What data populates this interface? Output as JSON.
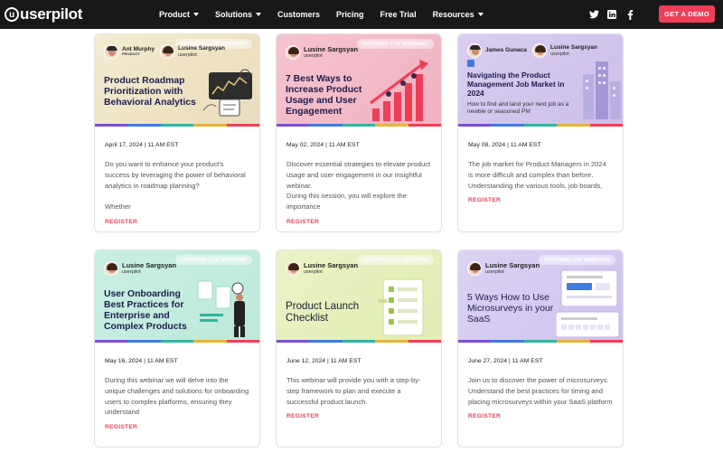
{
  "nav": {
    "logo": "userpilot",
    "logo_mark": "u",
    "items": [
      {
        "label": "Product",
        "dropdown": true
      },
      {
        "label": "Solutions",
        "dropdown": true
      },
      {
        "label": "Customers",
        "dropdown": false
      },
      {
        "label": "Pricing",
        "dropdown": false
      },
      {
        "label": "Free Trial",
        "dropdown": false
      },
      {
        "label": "Resources",
        "dropdown": true
      }
    ],
    "social": [
      "twitter-icon",
      "linkedin-icon",
      "facebook-icon"
    ],
    "cta": "GET A DEMO"
  },
  "colors": {
    "nav_bg": "#18181b",
    "accent": "#ef3e57",
    "title_navy": "#1d1d4f"
  },
  "cards": [
    {
      "badge": "UPCOMING LIVE WEBINARS",
      "hosts": [
        {
          "name": "Ant Murphy",
          "brand": "PRODUCT"
        },
        {
          "name": "Lusine Sargsyan",
          "brand": "userpilot"
        }
      ],
      "title": "Product Roadmap Prioritization with Behavioral Analytics",
      "date": "April 17, 2024 | 11 AM EST",
      "description": "Do you want to enhance your product's success by leveraging the power of behavioral analytics in roadmap planning?\n\nWhether",
      "register": "REGISTER"
    },
    {
      "badge": "UPCOMING LIVE WEBINARS",
      "hosts": [
        {
          "name": "Lusine Sargsyan",
          "brand": "userpilot"
        }
      ],
      "title": "7 Best Ways to Increase Product Usage and User Engagement",
      "date": "May 02, 2024 | 11 AM EST",
      "description": "Discover essential strategies to elevate product usage and user engagement in our insightful webinar.\nDuring this session, you will explore the importance",
      "register": "REGISTER"
    },
    {
      "badge": "",
      "hosts": [
        {
          "name": "James Gunaca",
          "brand": ""
        },
        {
          "name": "Lusine Sargsyan",
          "brand": "userpilot"
        }
      ],
      "title": "Navigating the Product Management Job Market in 2024",
      "subtitle": "How to find and land your next job as a newbie or seasoned PM",
      "date": "May 08, 2024 | 11 AM EST",
      "description": "The job market for Product Managers in 2024 is more difficult and complex than before. Understanding the various tools, job boards,",
      "register": "REGISTER"
    },
    {
      "badge": "UPCOMING LIVE WEBINARS",
      "hosts": [
        {
          "name": "Lusine Sargsyan",
          "brand": "userpilot"
        }
      ],
      "title": "User Onboarding Best Practices for Enterprise and Complex Products",
      "date": "May 16, 2024 | 11 AM EST",
      "description": "During this webinar we will delve into the unique challenges and solutions for onboarding users to complex platforms, ensuring they understand",
      "register": "REGISTER"
    },
    {
      "badge": "UPCOMING LIVE WEBINARS",
      "hosts": [
        {
          "name": "Lusine Sargsyan",
          "brand": "userpilot"
        }
      ],
      "title": "Product Launch Checklist",
      "date": "June 12, 2024 | 11 AM EST",
      "description": "This webinar will provide you with a step-by-step framework to plan and execute a successful product launch.",
      "register": "REGISTER"
    },
    {
      "badge": "UPCOMING LIVE WEBINARS",
      "hosts": [
        {
          "name": "Lusine Sargsyan",
          "brand": "userpilot"
        }
      ],
      "title": "5 Ways How to Use Microsurveys in your SaaS",
      "date": "June 27, 2024 | 11 AM EST",
      "description": "Join us to discover the power of microsurveys. Understand the best practices for timing and placing microsurveys within your SaaS platform",
      "register": "REGISTER"
    }
  ]
}
